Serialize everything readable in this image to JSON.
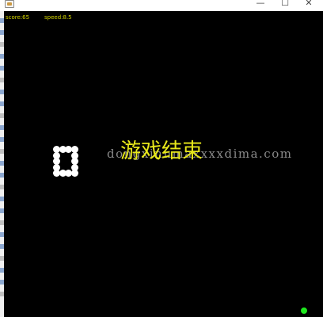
{
  "window": {
    "controls": {
      "minimize": "—",
      "maximize": "☐",
      "close": "✕"
    },
    "icon": "java-app-icon"
  },
  "hud": {
    "score": "score:65",
    "speed": "speed:8.5"
  },
  "game": {
    "status_text": "游戏结束",
    "watermark": "dongxinnmaxxxxdima.com",
    "snake_color": "#ffffff",
    "food_color": "#1ee81e",
    "background": "#000000",
    "hud_color": "#d6d600"
  }
}
